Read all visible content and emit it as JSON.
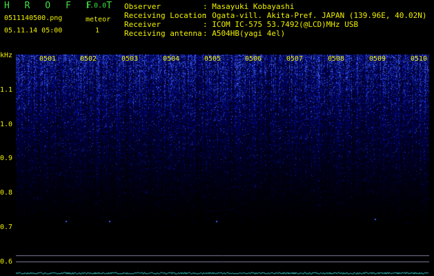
{
  "header": {
    "app_name": "H R O F F T",
    "version": "1.0.0",
    "filename": "0511140500.png",
    "datetime": "05.11.14 05:00",
    "meteor_label": "meteor",
    "meteor_count": "1"
  },
  "info": [
    {
      "key": "Observer",
      "value": ": Masayuki Kobayashi"
    },
    {
      "key": "Receiving Location",
      "value": ": Ogata-vill. Akita-Pref. JAPAN (139.96E, 40.02N)"
    },
    {
      "key": "Receiver",
      "value": ": ICOM IC-575 53.7492(@LCD)MHz USB"
    },
    {
      "key": "Receiving antenna",
      "value": ": A504HB(yagi 4el)"
    }
  ],
  "plot": {
    "y_unit": "kHz",
    "y_labels": [
      "1.1",
      "1.0",
      "0.9",
      "0.8",
      "0.7",
      "0.6"
    ],
    "x_labels": [
      "0501",
      "0502",
      "0503",
      "0504",
      "0505",
      "0506",
      "0507",
      "0508",
      "0509",
      "0510"
    ]
  },
  "colors": {
    "signal": "#2030ff",
    "label_yellow": "#f0f000",
    "title_green": "#40e040"
  }
}
